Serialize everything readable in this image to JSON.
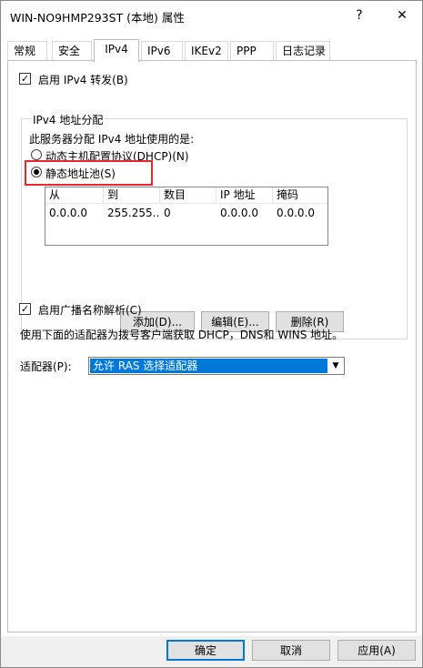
{
  "window": {
    "title": "WIN-NO9HMP293ST (本地) 属性",
    "help_glyph": "?",
    "close_glyph": "✕"
  },
  "tabs": [
    {
      "label": "常规"
    },
    {
      "label": "安全"
    },
    {
      "label": "IPv4",
      "active": true
    },
    {
      "label": "IPv6"
    },
    {
      "label": "IKEv2"
    },
    {
      "label": "PPP"
    },
    {
      "label": "日志记录"
    }
  ],
  "ipv4": {
    "forwarding": {
      "label": "启用 IPv4 转发(B)",
      "checked": true,
      "mark": "✓"
    },
    "allocation": {
      "group_title": "IPv4 地址分配",
      "description": "此服务器分配 IPv4 地址使用的是:",
      "dhcp": {
        "label": "动态主机配置协议(DHCP)(N)",
        "selected": false
      },
      "static_pool": {
        "label": "静态地址池(S)",
        "selected": true
      },
      "columns": [
        "从",
        "到",
        "数目",
        "IP 地址",
        "掩码"
      ],
      "rows": [
        {
          "from": "0.0.0.0",
          "to": "255.255....",
          "count": "0",
          "ip": "0.0.0.0",
          "mask": "0.0.0.0"
        }
      ],
      "add_label": "添加(D)...",
      "edit_label": "编辑(E)...",
      "delete_label": "删除(R)"
    },
    "broadcast": {
      "label": "启用广播名称解析(C)",
      "checked": true,
      "mark": "✓"
    },
    "adapter_description": "使用下面的适配器为拨号客户端获取 DHCP，DNS和 WINS 地址。",
    "adapter": {
      "label": "适配器(P):",
      "value": "允许 RAS 选择适配器",
      "arrow": "▼"
    }
  },
  "footer": {
    "ok_label": "确定",
    "cancel_label": "取消",
    "apply_label": "应用(A)"
  },
  "colors": {
    "highlight_box": "#e8282e",
    "selection": "#0078d7"
  }
}
